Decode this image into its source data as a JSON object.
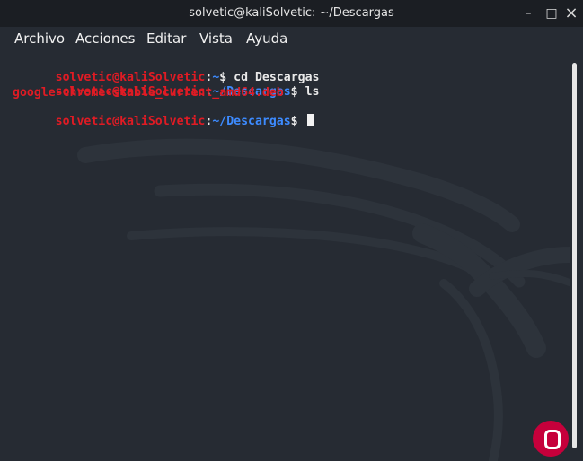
{
  "window": {
    "title": "solvetic@kaliSolvetic: ~/Descargas"
  },
  "menu": {
    "items": [
      "Archivo",
      "Acciones",
      "Editar",
      "Vista",
      "Ayuda"
    ]
  },
  "controls": {
    "minimize": "–",
    "maximize": "□",
    "close": "×"
  },
  "terminal": {
    "lines": [
      {
        "user": "solvetic@kaliSolvetic",
        "colon": ":",
        "path": "~",
        "prompt": "$ ",
        "cmd": "cd Descargas"
      },
      {
        "user": "solvetic@kaliSolvetic",
        "colon": ":",
        "path": "~/Descargas",
        "prompt": "$ ",
        "cmd": "ls"
      },
      {
        "output": "google-chrome-stable_current_amd64.deb"
      },
      {
        "user": "solvetic@kaliSolvetic",
        "colon": ":",
        "path": "~/Descargas",
        "prompt": "$ ",
        "cmd": ""
      }
    ]
  },
  "colors": {
    "user": "#e01b24",
    "path": "#3d8bff",
    "file": "#e01b24",
    "background": "#262b33",
    "text": "#e9e9e9"
  },
  "icons": [
    "minimize-icon",
    "maximize-icon",
    "close-icon",
    "cursor-icon"
  ]
}
